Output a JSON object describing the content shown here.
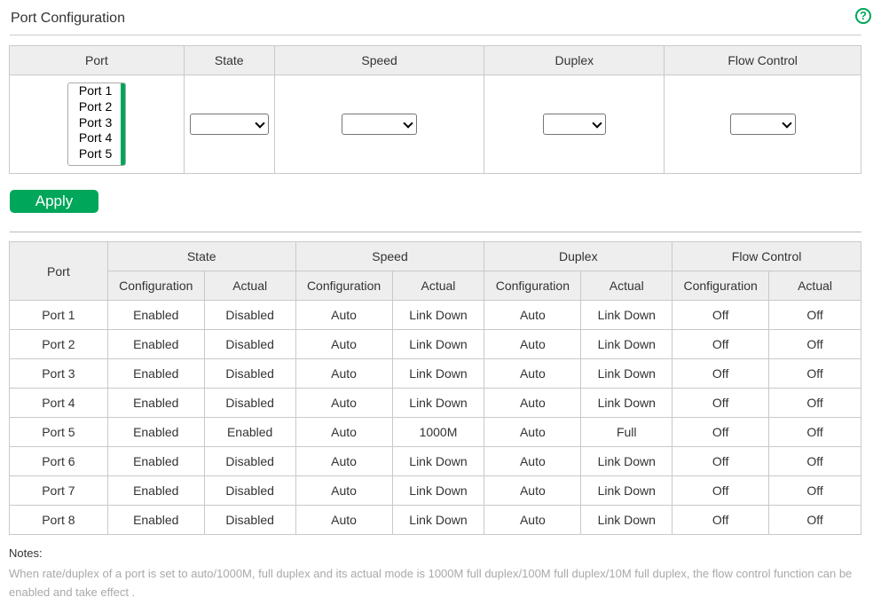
{
  "header": {
    "title": "Port Configuration",
    "help_icon": "?"
  },
  "config_table": {
    "headers": [
      "Port",
      "State",
      "Speed",
      "Duplex",
      "Flow Control"
    ],
    "port_options": [
      "Port 1",
      "Port 2",
      "Port 3",
      "Port 4",
      "Port 5"
    ],
    "state_value": "",
    "speed_value": "",
    "duplex_value": "",
    "flow_control_value": ""
  },
  "apply_label": "Apply",
  "status_table": {
    "group_headers": [
      "Port",
      "State",
      "Speed",
      "Duplex",
      "Flow Control"
    ],
    "sub_headers": [
      "Configuration",
      "Actual",
      "Configuration",
      "Actual",
      "Configuration",
      "Actual",
      "Configuration",
      "Actual"
    ],
    "rows": [
      [
        "Port 1",
        "Enabled",
        "Disabled",
        "Auto",
        "Link Down",
        "Auto",
        "Link Down",
        "Off",
        "Off"
      ],
      [
        "Port 2",
        "Enabled",
        "Disabled",
        "Auto",
        "Link Down",
        "Auto",
        "Link Down",
        "Off",
        "Off"
      ],
      [
        "Port 3",
        "Enabled",
        "Disabled",
        "Auto",
        "Link Down",
        "Auto",
        "Link Down",
        "Off",
        "Off"
      ],
      [
        "Port 4",
        "Enabled",
        "Disabled",
        "Auto",
        "Link Down",
        "Auto",
        "Link Down",
        "Off",
        "Off"
      ],
      [
        "Port 5",
        "Enabled",
        "Enabled",
        "Auto",
        "1000M",
        "Auto",
        "Full",
        "Off",
        "Off"
      ],
      [
        "Port 6",
        "Enabled",
        "Disabled",
        "Auto",
        "Link Down",
        "Auto",
        "Link Down",
        "Off",
        "Off"
      ],
      [
        "Port 7",
        "Enabled",
        "Disabled",
        "Auto",
        "Link Down",
        "Auto",
        "Link Down",
        "Off",
        "Off"
      ],
      [
        "Port 8",
        "Enabled",
        "Disabled",
        "Auto",
        "Link Down",
        "Auto",
        "Link Down",
        "Off",
        "Off"
      ]
    ]
  },
  "notes": {
    "title": "Notes:",
    "text": "When rate/duplex of a port is set to auto/1000M, full duplex and its actual mode is 1000M full duplex/100M full duplex/10M full duplex, the flow control function can be enabled and take effect ."
  },
  "colors": {
    "accent": "#00a65a",
    "header_bg": "#eeeeee",
    "border": "#c9c9c9",
    "note_text": "#a9a9a9"
  }
}
